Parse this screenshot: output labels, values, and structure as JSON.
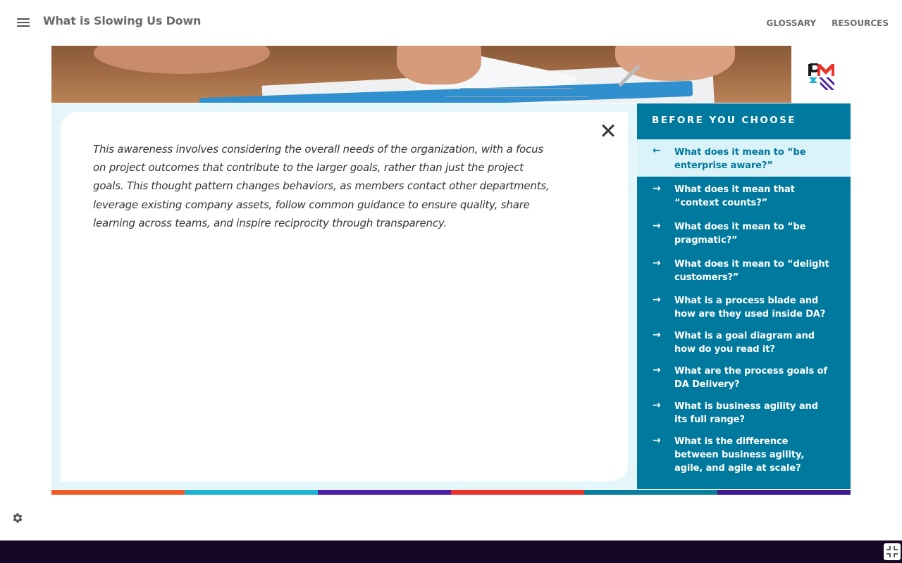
{
  "header": {
    "title": "What is Slowing Us Down",
    "nav": [
      {
        "label": "GLOSSARY"
      },
      {
        "label": "RESOURCES"
      }
    ]
  },
  "content": {
    "body": "This awareness involves considering the overall needs of the organization, with a focus on project outcomes that contribute to the larger goals, rather than just the project goals. This thought pattern changes behaviors, as members contact other departments, leverage existing company assets, follow common guidance to ensure quality, share learning across teams, and inspire reciprocity through transparency."
  },
  "sidebar": {
    "heading": "BEFORE YOU CHOOSE",
    "items": [
      {
        "label": "What does it mean to “be enterprise aware?”",
        "arrow": "←",
        "active": true
      },
      {
        "label": "What does it mean that “context counts?”",
        "arrow": "→"
      },
      {
        "label": "What does it mean to “be pragmatic?”",
        "arrow": "→"
      },
      {
        "label": "What does it mean to “delight customers?”",
        "arrow": "→"
      },
      {
        "label": "What is a process blade and how are they used inside DA?",
        "arrow": "→"
      },
      {
        "label": "What is a goal diagram and how do you read it?",
        "arrow": "→"
      },
      {
        "label": "What are the process goals of DA Delivery?",
        "arrow": "→"
      },
      {
        "label": "What is business agility and its full range?",
        "arrow": "→"
      },
      {
        "label": "What is the difference between business agility, agile, and agile at scale?",
        "arrow": "→"
      }
    ]
  },
  "colors": {
    "sidebar_bg": "#00799e",
    "active_item_bg": "#d9f3f8",
    "content_bg": "#e4f6f9",
    "bottom_bar": "#170624",
    "strip": [
      "#f15a29",
      "#1ab3d4",
      "#4b1fa6",
      "#e8352c",
      "#0a7e9e",
      "#3d1a8f"
    ]
  },
  "icons": {
    "menu": "hamburger-icon",
    "close": "close-icon",
    "settings": "gear-icon",
    "fullscreen": "exit-fullscreen-icon",
    "logo": "pmi-logo"
  }
}
